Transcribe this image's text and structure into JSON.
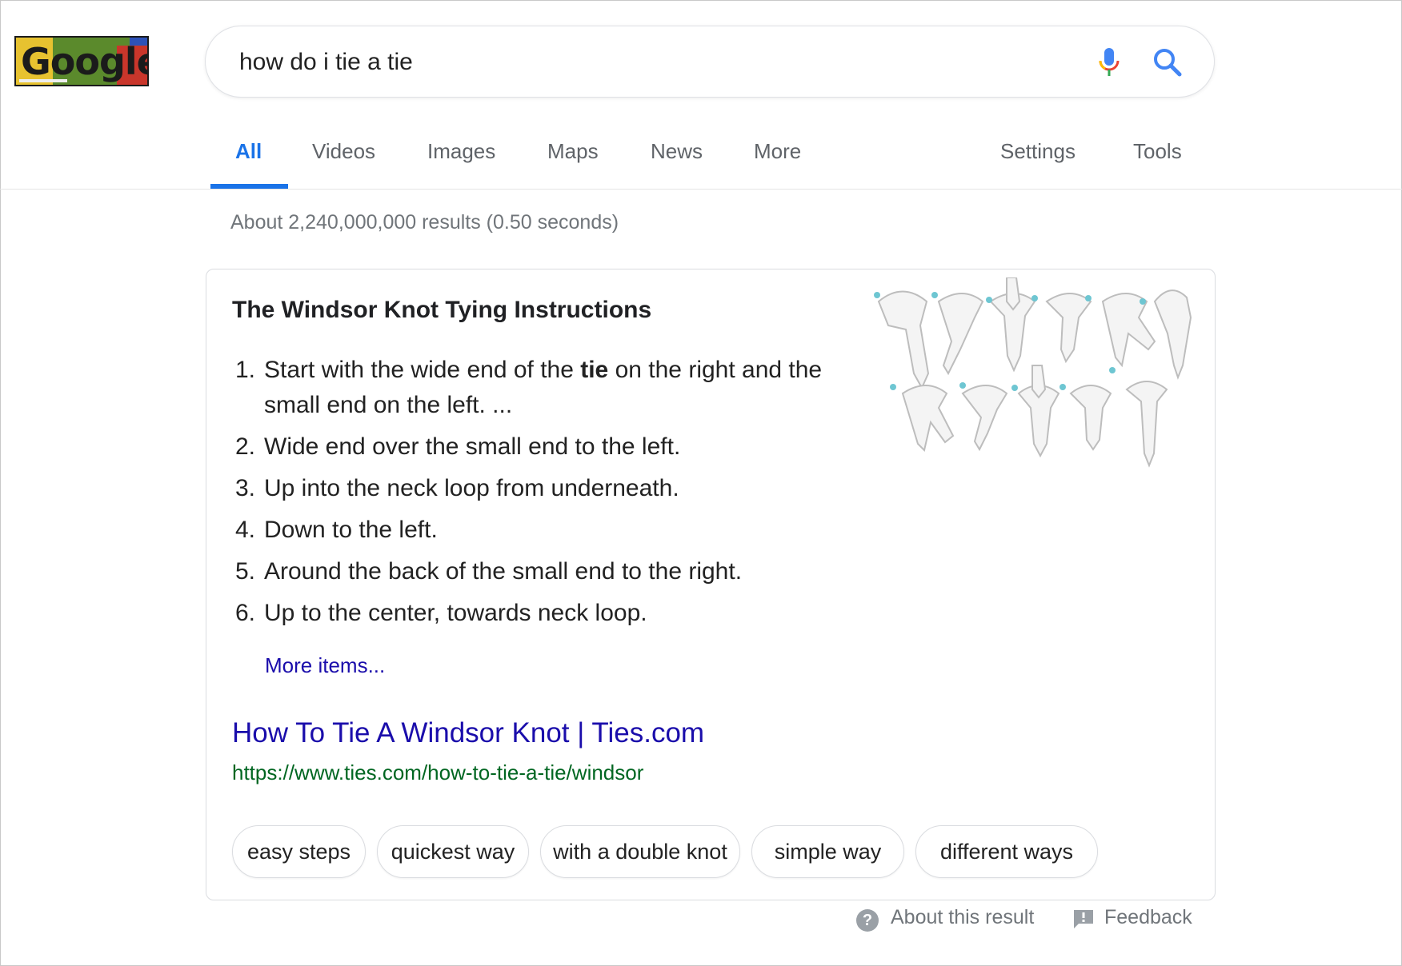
{
  "logo": {
    "text": "Google"
  },
  "search": {
    "query": "how do i tie a tie"
  },
  "tabs": [
    {
      "label": "All"
    },
    {
      "label": "Videos"
    },
    {
      "label": "Images"
    },
    {
      "label": "Maps"
    },
    {
      "label": "News"
    },
    {
      "label": "More"
    }
  ],
  "tools": {
    "settings": "Settings",
    "tools": "Tools"
  },
  "stats": "About 2,240,000,000 results (0.50 seconds)",
  "snippet": {
    "title": "The Windsor Knot Tying Instructions",
    "steps": [
      {
        "num": "1.",
        "pre": "Start with the wide end of the ",
        "bold": "tie",
        "post": " on the right and the small end on the left. ..."
      },
      {
        "num": "2.",
        "text": "Wide end over the small end to the left."
      },
      {
        "num": "3.",
        "text": "Up into the neck loop from underneath."
      },
      {
        "num": "4.",
        "text": "Down to the left."
      },
      {
        "num": "5.",
        "text": "Around the back of the small end to the right."
      },
      {
        "num": "6.",
        "text": "Up to the center, towards neck loop."
      }
    ],
    "more_items": "More items...",
    "link_title": "How To Tie A Windsor Knot | Ties.com",
    "url": "https://www.ties.com/how-to-tie-a-tie/windsor",
    "chips": [
      "easy steps",
      "quickest way",
      "with a double knot",
      "simple way",
      "different ways"
    ]
  },
  "footer": {
    "about": "About this result",
    "feedback": "Feedback"
  },
  "colors": {
    "accent": "#1a73e8",
    "link": "#1a0dab",
    "url": "#006621",
    "muted": "#70757a"
  }
}
